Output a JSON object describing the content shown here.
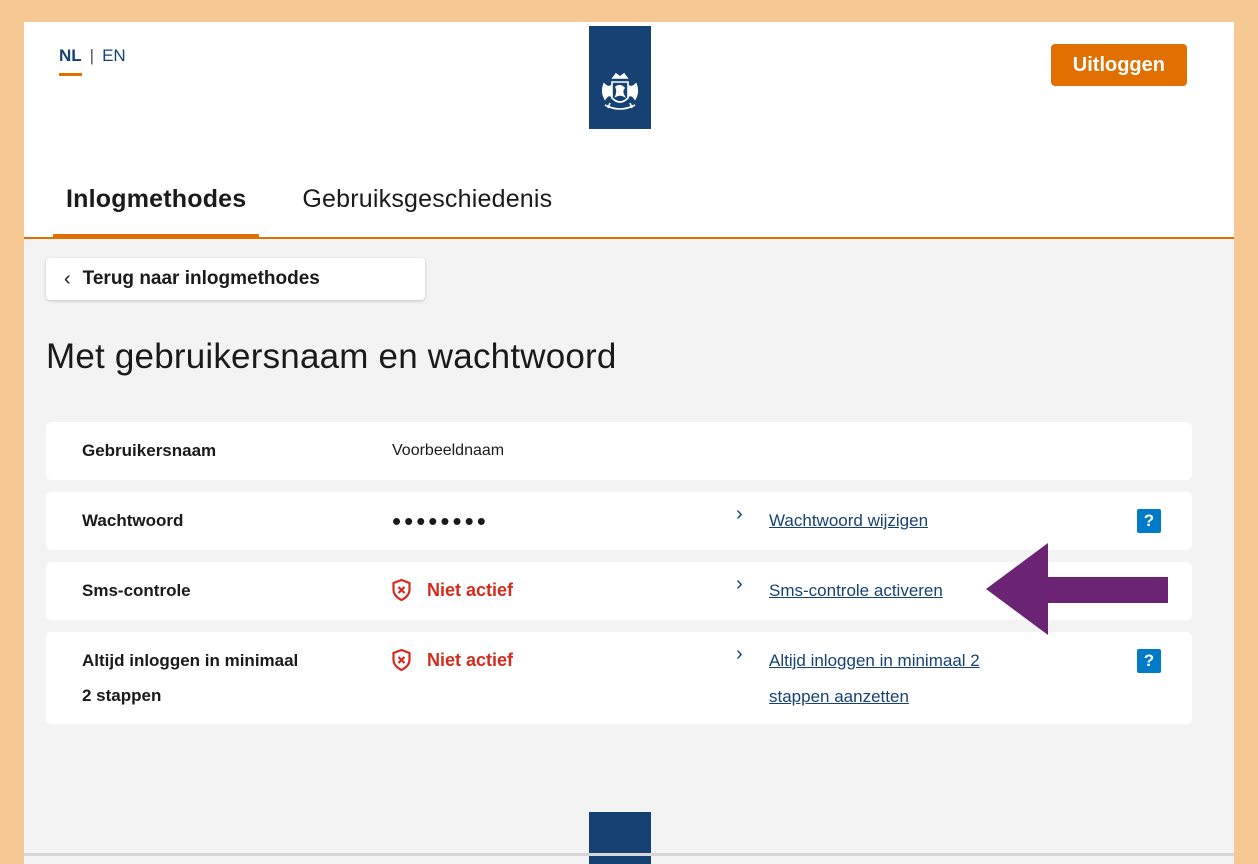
{
  "language": {
    "active": "NL",
    "separator": "|",
    "other": "EN"
  },
  "header": {
    "logo_icon": "rijksoverheid-coat-of-arms-icon",
    "logout_label": "Uitloggen"
  },
  "tabs": [
    {
      "label": "Inlogmethodes",
      "active": true
    },
    {
      "label": "Gebruiksgeschiedenis",
      "active": false
    }
  ],
  "back_button": {
    "label": "Terug naar inlogmethodes",
    "icon": "chevron-left-icon"
  },
  "page_title": "Met gebruikersnaam en wachtwoord",
  "rows": [
    {
      "label": "Gebruikersnaam",
      "value": "Voorbeeldnaam"
    },
    {
      "label": "Wachtwoord",
      "value": "••••••••",
      "link": "Wachtwoord wijzigen",
      "help": "?"
    },
    {
      "label": "Sms-controle",
      "status": "Niet actief",
      "link": "Sms-controle activeren"
    },
    {
      "label_line1": "Altijd inloggen in minimaal",
      "label_line2": "2 stappen",
      "status": "Niet actief",
      "link_line1": "Altijd inloggen in minimaal 2",
      "link_line2": "stappen aanzetten",
      "help": "?"
    }
  ],
  "colors": {
    "accent": "#e17000",
    "brand_blue": "#154273",
    "status_red": "#d52b1e",
    "help_blue": "#007bc7",
    "annotation_arrow": "#6b2373",
    "outer_border": "#f6c893"
  },
  "annotation": {
    "icon": "pointing-arrow-icon"
  }
}
